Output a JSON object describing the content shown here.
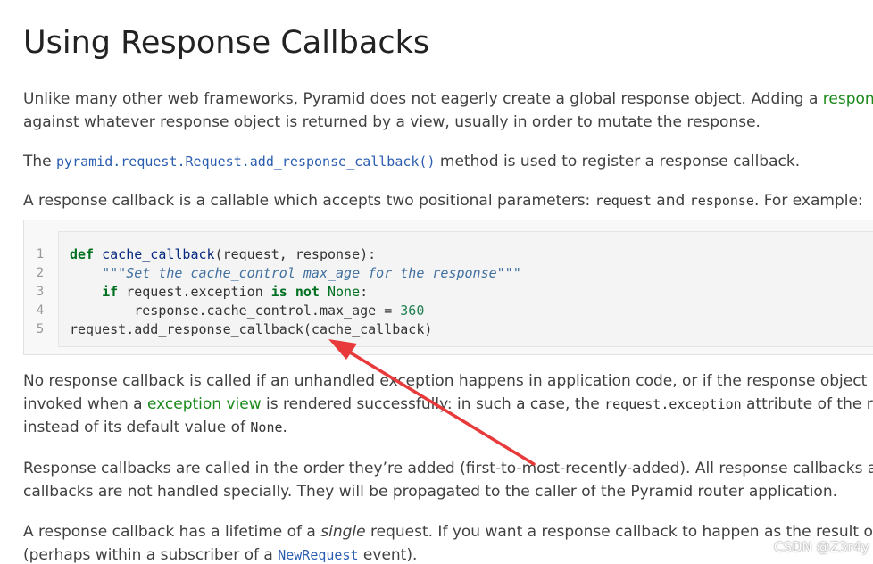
{
  "heading": "Using Response Callbacks",
  "para1": {
    "line1_prefix": "Unlike many other web frameworks, Pyramid does not eagerly create a global response object. Adding a ",
    "line1_link": "response",
    "line2": "against whatever response object is returned by a view, usually in order to mutate the response."
  },
  "para2": {
    "prefix": "The ",
    "link": "pyramid.request.Request.add_response_callback()",
    "suffix": " method is used to register a response callback."
  },
  "para3": {
    "prefix": "A response callback is a callable which accepts two positional parameters: ",
    "code1": "request",
    "middle": " and ",
    "code2": "response",
    "suffix": ". For example:"
  },
  "code_block": {
    "line_numbers": [
      "1",
      "2",
      "3",
      "4",
      "5"
    ],
    "lines": [
      "def cache_callback(request, response):",
      "    \"\"\"Set the cache_control max_age for the response\"\"\"",
      "    if request.exception is not None:",
      "        response.cache_control.max_age = 360",
      "request.add_response_callback(cache_callback)"
    ],
    "tokens": {
      "def": "def",
      "fn_name": "cache_callback",
      "params": "(request, response):",
      "docstring": "\"\"\"Set the cache_control max_age for the response\"\"\"",
      "if": "if",
      "req_exc": " request.exception ",
      "is": "is",
      "not": "not",
      "none": "None",
      "colon": ":",
      "assign": "response.cache_control.max_age = ",
      "num": "360",
      "last": "request.add_response_callback(cache_callback)"
    }
  },
  "para4": {
    "line1": "No response callback is called if an unhandled exception happens in application code, or if the response object re",
    "line2_prefix": "invoked when a ",
    "line2_link": "exception view",
    "line2_middle": " is rendered successfully: in such a case, the ",
    "line2_code": "request.exception",
    "line2_suffix": " attribute of the req",
    "line3_prefix": "instead of its default value of ",
    "line3_code": "None",
    "line3_suffix": "."
  },
  "para5": {
    "line1": "Response callbacks are called in the order they’re added (first-to-most-recently-added). All response callbacks ar",
    "line2": "callbacks are not handled specially. They will be propagated to the caller of the Pyramid router application."
  },
  "para6": {
    "line1_prefix": "A response callback has a lifetime of a ",
    "line1_em": "single",
    "line1_suffix": " request. If you want a response callback to happen as the result of ev",
    "line2_prefix": "(perhaps within a subscriber of a ",
    "line2_link": "NewRequest",
    "line2_suffix": " event)."
  },
  "watermark": "CSDN @Z3r4y",
  "colors": {
    "heading": "#222222",
    "body_text": "#404040",
    "term_link": "#1b8a1b",
    "code_link": "#2a5db0",
    "keyword": "#007020",
    "docstring": "#4070a0",
    "arrow": "#e83a3a"
  }
}
